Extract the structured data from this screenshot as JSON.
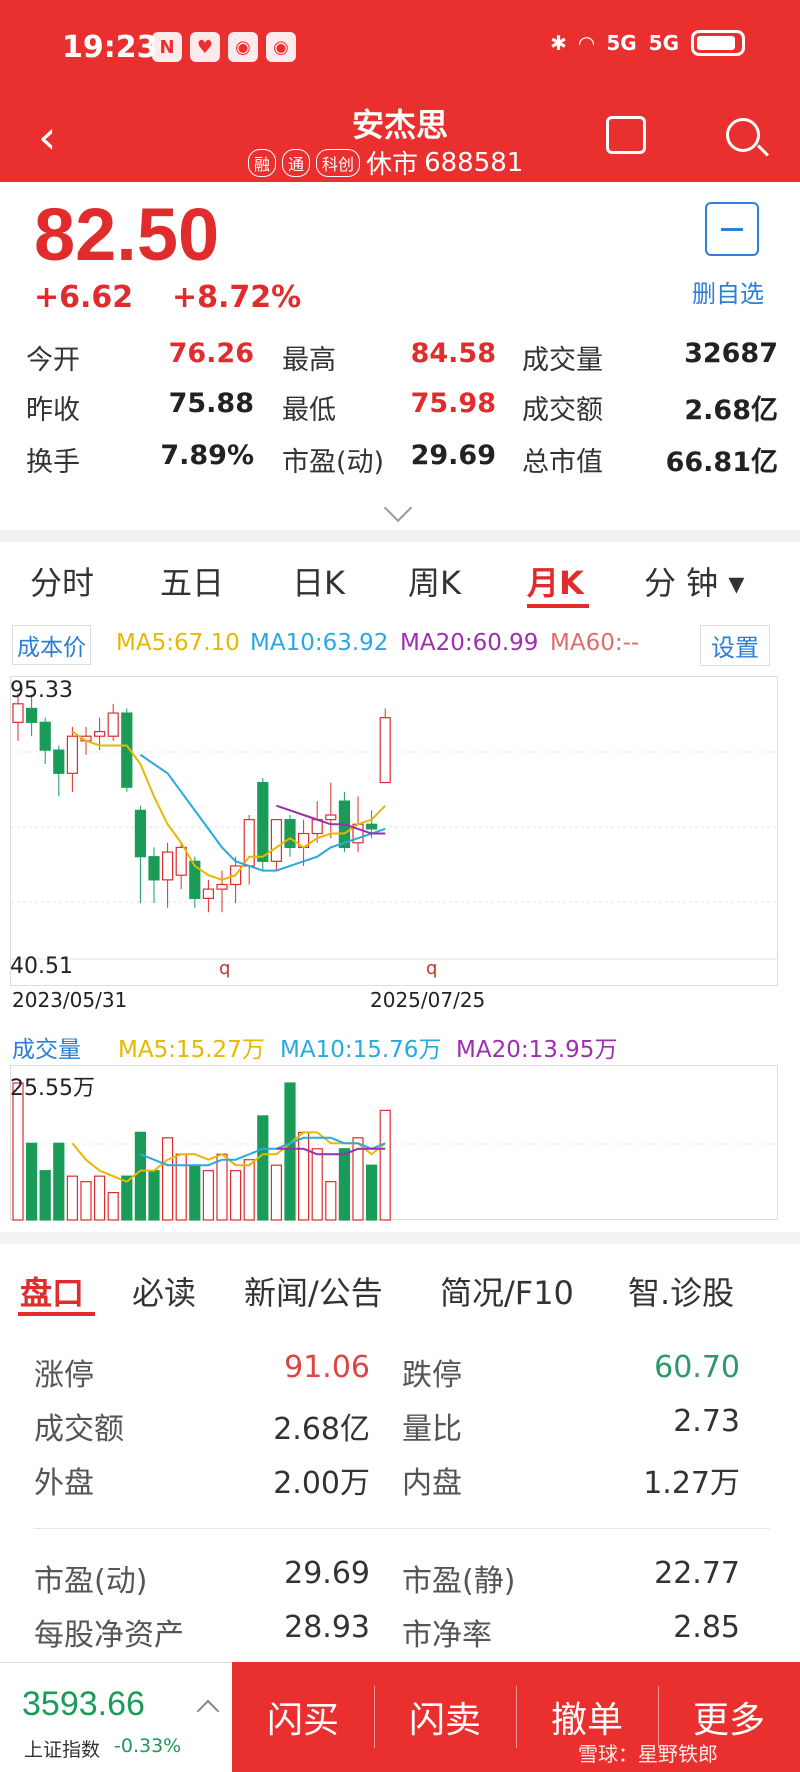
{
  "status_bar": {
    "time": "19:23",
    "icons": [
      "nfc-icon",
      "heart-icon",
      "weibo-icon",
      "weibo-icon"
    ],
    "network": "5G"
  },
  "header": {
    "back": "‹",
    "title": "安杰思",
    "tags": [
      "融",
      "通",
      "科创"
    ],
    "status": "休市",
    "code": "688581"
  },
  "quote": {
    "price": "82.50",
    "change": "+6.62",
    "change_pct": "+8.72%",
    "fav_label": "删自选",
    "rows": [
      [
        {
          "label": "今开",
          "value": "76.26",
          "color": "#e02c2c"
        },
        {
          "label": "最高",
          "value": "84.58",
          "color": "#e02c2c"
        },
        {
          "label": "成交量",
          "value": "32687",
          "color": "#222"
        }
      ],
      [
        {
          "label": "昨收",
          "value": "75.88",
          "color": "#222"
        },
        {
          "label": "最低",
          "value": "75.98",
          "color": "#e02c2c"
        },
        {
          "label": "成交额",
          "value": "2.68亿",
          "color": "#222"
        }
      ],
      [
        {
          "label": "换手",
          "value": "7.89%",
          "color": "#222"
        },
        {
          "label": "市盈(动)",
          "value": "29.69",
          "color": "#222"
        },
        {
          "label": "总市值",
          "value": "66.81亿",
          "color": "#222"
        }
      ]
    ]
  },
  "chart_tabs": [
    "分时",
    "五日",
    "日K",
    "周K",
    "月K",
    "分 钟 ▾"
  ],
  "active_chart_tab": "月K",
  "ma_legend": {
    "cost": "成本价",
    "items": [
      {
        "text": "MA5:67.10",
        "color": "#e6b800"
      },
      {
        "text": "MA10:63.92",
        "color": "#29a9e1"
      },
      {
        "text": "MA20:60.99",
        "color": "#9b2fae"
      },
      {
        "text": "MA60:--",
        "color": "#e26b6b"
      }
    ],
    "settings": "设置"
  },
  "chart_data": {
    "type": "candlestick",
    "title": "",
    "ylim": [
      40.51,
      95.33
    ],
    "y_top_label": "95.33",
    "y_bottom_label": "40.51",
    "x_start_label": "2023/05/31",
    "x_end_label": "2025/07/25",
    "markers": [
      "q",
      "q"
    ],
    "candles": [
      {
        "o": 89,
        "c": 93,
        "h": 95.3,
        "l": 85
      },
      {
        "o": 92,
        "c": 89,
        "h": 95,
        "l": 86
      },
      {
        "o": 89,
        "c": 83,
        "h": 90,
        "l": 80
      },
      {
        "o": 83,
        "c": 78,
        "h": 84,
        "l": 73
      },
      {
        "o": 78,
        "c": 86,
        "h": 88,
        "l": 74
      },
      {
        "o": 85,
        "c": 86,
        "h": 88,
        "l": 82
      },
      {
        "o": 86,
        "c": 87,
        "h": 90,
        "l": 83
      },
      {
        "o": 86,
        "c": 91,
        "h": 93,
        "l": 85
      },
      {
        "o": 91,
        "c": 75,
        "h": 92,
        "l": 74
      },
      {
        "o": 70,
        "c": 60,
        "h": 71,
        "l": 50
      },
      {
        "o": 60,
        "c": 55,
        "h": 62,
        "l": 50
      },
      {
        "o": 55,
        "c": 61,
        "h": 63,
        "l": 49
      },
      {
        "o": 56,
        "c": 62,
        "h": 63,
        "l": 53
      },
      {
        "o": 59,
        "c": 51,
        "h": 60,
        "l": 49
      },
      {
        "o": 51,
        "c": 53,
        "h": 55,
        "l": 48
      },
      {
        "o": 53,
        "c": 54,
        "h": 57,
        "l": 48
      },
      {
        "o": 54,
        "c": 58,
        "h": 60,
        "l": 50
      },
      {
        "o": 58,
        "c": 68,
        "h": 69,
        "l": 54
      },
      {
        "o": 76,
        "c": 59,
        "h": 77,
        "l": 57
      },
      {
        "o": 59,
        "c": 68,
        "h": 68,
        "l": 57
      },
      {
        "o": 68,
        "c": 62,
        "h": 69,
        "l": 60
      },
      {
        "o": 62,
        "c": 65,
        "h": 68,
        "l": 58
      },
      {
        "o": 65,
        "c": 68,
        "h": 72,
        "l": 63
      },
      {
        "o": 68,
        "c": 69,
        "h": 76,
        "l": 64
      },
      {
        "o": 72,
        "c": 62,
        "h": 74,
        "l": 61
      },
      {
        "o": 63,
        "c": 67,
        "h": 73,
        "l": 61
      },
      {
        "o": 67,
        "c": 66,
        "h": 70,
        "l": 64
      },
      {
        "o": 76,
        "c": 90,
        "h": 92,
        "l": 76
      }
    ],
    "ma5": [
      null,
      null,
      null,
      null,
      87,
      85,
      84,
      84,
      84,
      80,
      73,
      67,
      63,
      58,
      56,
      55,
      56,
      60,
      60,
      62,
      64,
      62,
      64,
      65,
      65,
      67,
      68,
      71
    ],
    "ma10": [
      null,
      null,
      null,
      null,
      null,
      null,
      null,
      null,
      null,
      82,
      80,
      78,
      74,
      70,
      66,
      62,
      59,
      58,
      57,
      57,
      58,
      59,
      60,
      62,
      63,
      64,
      65,
      66
    ],
    "ma20": [
      null,
      null,
      null,
      null,
      null,
      null,
      null,
      null,
      null,
      null,
      null,
      null,
      null,
      null,
      null,
      null,
      null,
      null,
      null,
      71,
      70,
      69,
      68,
      67,
      67,
      66,
      65,
      65
    ]
  },
  "volume": {
    "legend_title": "成交量",
    "items": [
      {
        "text": "MA5:15.27万",
        "color": "#e6b800"
      },
      {
        "text": "MA10:15.76万",
        "color": "#29a9e1"
      },
      {
        "text": "MA20:13.95万",
        "color": "#9b2fae"
      }
    ],
    "max_label": "25.55万",
    "values": [
      25,
      14,
      9,
      14,
      8,
      7,
      8,
      5,
      8,
      16,
      9,
      15,
      12,
      10,
      9,
      12,
      9,
      11,
      19,
      10,
      25,
      16,
      13,
      7,
      13,
      15,
      10,
      20
    ],
    "ma5": [
      null,
      null,
      null,
      null,
      14,
      11,
      9,
      8,
      7,
      9,
      9,
      11,
      12,
      12,
      11,
      12,
      10,
      10,
      12,
      12,
      14,
      16,
      16,
      14,
      14,
      14,
      12,
      14
    ],
    "ma10": [
      null,
      null,
      null,
      null,
      null,
      null,
      null,
      null,
      null,
      12,
      11,
      10,
      10,
      10,
      10,
      11,
      11,
      12,
      13,
      13,
      14,
      15,
      15,
      15,
      14,
      14,
      13,
      14
    ],
    "ma20": [
      null,
      null,
      null,
      null,
      null,
      null,
      null,
      null,
      null,
      null,
      null,
      null,
      null,
      null,
      null,
      null,
      null,
      null,
      null,
      13,
      13,
      13,
      12,
      12,
      12,
      13,
      13,
      13
    ]
  },
  "bottom_tabs": [
    "盘口",
    "必读",
    "新闻/公告",
    "简况/F10",
    "智.诊股"
  ],
  "active_bottom_tab": "盘口",
  "panel": {
    "rows": [
      [
        {
          "label": "涨停",
          "value": "91.06",
          "color": "#e04343"
        },
        {
          "label": "跌停",
          "value": "60.70",
          "color": "#2a9a6a"
        }
      ],
      [
        {
          "label": "成交额",
          "value": "2.68亿",
          "color": "#333"
        },
        {
          "label": "量比",
          "value": "2.73",
          "color": "#333"
        }
      ],
      [
        {
          "label": "外盘",
          "value": "2.00万",
          "color": "#333"
        },
        {
          "label": "内盘",
          "value": "1.27万",
          "color": "#333"
        }
      ],
      [
        {
          "label": "市盈(动)",
          "value": "29.69",
          "color": "#333"
        },
        {
          "label": "市盈(静)",
          "value": "22.77",
          "color": "#333"
        }
      ],
      [
        {
          "label": "每股净资产",
          "value": "28.93",
          "color": "#333"
        },
        {
          "label": "市净率",
          "value": "2.85",
          "color": "#333"
        }
      ]
    ]
  },
  "footer": {
    "index_value": "3593.66",
    "index_name": "上证指数",
    "index_change": "-0.33%",
    "buttons": [
      "闪买",
      "闪卖",
      "撤单",
      "更多"
    ],
    "watermark": "雪球：星野铁郎"
  },
  "colors": {
    "brand_red": "#e9302f",
    "up": "#e02c2c",
    "down": "#1a9b58"
  }
}
